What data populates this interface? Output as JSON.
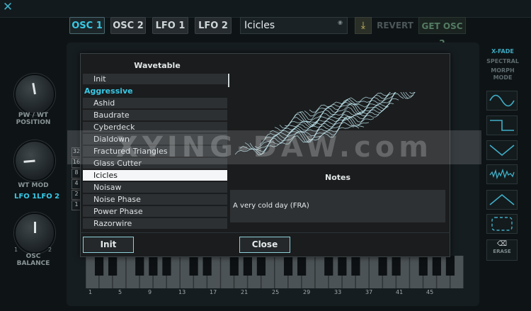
{
  "header": {
    "close_icon": "close-icon",
    "tabs": [
      {
        "label": "OSC 1",
        "active": true
      },
      {
        "label": "OSC 2",
        "active": false
      },
      {
        "label": "LFO 1",
        "active": false
      },
      {
        "label": "LFO 2",
        "active": false
      }
    ],
    "preset_name": "Icicles",
    "download_icon": "download-icon",
    "revert_label": "REVERT",
    "get_osc_label": "GET OSC 2"
  },
  "left_panel": {
    "knob1_label": "PW / WT\nPOSITION",
    "knob2_label": "WT MOD",
    "lfo1": "LFO 1",
    "lfo2": "LFO 2",
    "knob3_label": "OSC\nBALANCE",
    "balance_min": "1",
    "balance_max": "2",
    "octave_labels": [
      "32",
      "16",
      "8",
      "4",
      "2",
      "1"
    ]
  },
  "right_panel": {
    "xfade_label": "X-FADE",
    "spectral_label": "SPECTRAL",
    "morph_label": "MORPH\nMODE",
    "erase_label": "ERASE"
  },
  "modal": {
    "wavetable_title": "Wavetable",
    "list": [
      {
        "label": "Init",
        "type": "item"
      },
      {
        "label": "Aggressive",
        "type": "category"
      },
      {
        "label": "Ashid",
        "type": "item"
      },
      {
        "label": "Baudrate",
        "type": "item"
      },
      {
        "label": "Cyberdeck",
        "type": "item"
      },
      {
        "label": "Dialdown",
        "type": "item"
      },
      {
        "label": "Fractured Triangles",
        "type": "item"
      },
      {
        "label": "Glass Cutter",
        "type": "item"
      },
      {
        "label": "Icicles",
        "type": "item",
        "selected": true
      },
      {
        "label": "Noisaw",
        "type": "item"
      },
      {
        "label": "Noise Phase",
        "type": "item"
      },
      {
        "label": "Power Phase",
        "type": "item"
      },
      {
        "label": "Razorwire",
        "type": "item"
      }
    ],
    "notes_title": "Notes",
    "notes_text": "A very cold day (FRA)",
    "init_button": "Init",
    "close_button": "Close"
  },
  "keyboard": {
    "key_numbers": [
      "1",
      "5",
      "9",
      "13",
      "17",
      "21",
      "25",
      "29",
      "33",
      "37",
      "41",
      "45"
    ]
  },
  "watermark": "XYING-DAW.com",
  "colors": {
    "accent": "#38c9e6",
    "panel": "#1a1c1d",
    "list_item": "#2d3033",
    "selected": "#f4f6f7"
  }
}
